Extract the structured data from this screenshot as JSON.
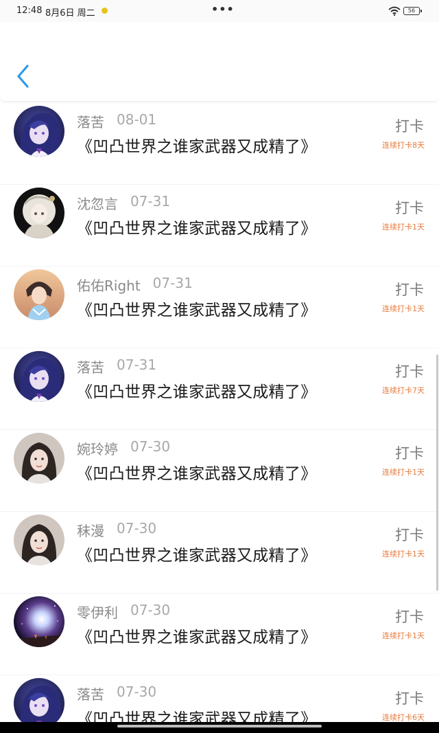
{
  "status_bar": {
    "time": "12:48",
    "date": "8月6日 周二",
    "more": "•••",
    "battery": "56"
  },
  "header": {
    "back_icon": "chevron-left-icon",
    "accent_color": "#2b9be8"
  },
  "colors": {
    "streak": "#e57a3c",
    "name": "#8a8a8a",
    "title": "#1a1a1a"
  },
  "entries": [
    {
      "name": "落苦",
      "date": "08-01",
      "title": "《凹凸世界之谁家武器又成精了》",
      "action": "打卡",
      "streak": "连续打卡8天",
      "avatar": "purple-hair-avatar"
    },
    {
      "name": "沈忽言",
      "date": "07-31",
      "title": "《凹凸世界之谁家武器又成精了》",
      "action": "打卡",
      "streak": "连续打卡1天",
      "avatar": "white-hair-avatar"
    },
    {
      "name": "佑佑Right",
      "date": "07-31",
      "title": "《凹凸世界之谁家武器又成精了》",
      "action": "打卡",
      "streak": "连续打卡1天",
      "avatar": "cosplay-avatar"
    },
    {
      "name": "落苦",
      "date": "07-31",
      "title": "《凹凸世界之谁家武器又成精了》",
      "action": "打卡",
      "streak": "连续打卡7天",
      "avatar": "purple-hair-avatar"
    },
    {
      "name": "婉玲婷",
      "date": "07-30",
      "title": "《凹凸世界之谁家武器又成精了》",
      "action": "打卡",
      "streak": "连续打卡1天",
      "avatar": "photo-avatar"
    },
    {
      "name": "秣漫",
      "date": "07-30",
      "title": "《凹凸世界之谁家武器又成精了》",
      "action": "打卡",
      "streak": "连续打卡1天",
      "avatar": "photo-avatar"
    },
    {
      "name": "零伊利",
      "date": "07-30",
      "title": "《凹凸世界之谁家武器又成精了》",
      "action": "打卡",
      "streak": "连续打卡1天",
      "avatar": "galaxy-avatar"
    },
    {
      "name": "落苦",
      "date": "07-30",
      "title": "《凹凸世界之谁家武器又成精了》",
      "action": "打卡",
      "streak": "连续打卡6天",
      "avatar": "purple-hair-avatar"
    }
  ]
}
